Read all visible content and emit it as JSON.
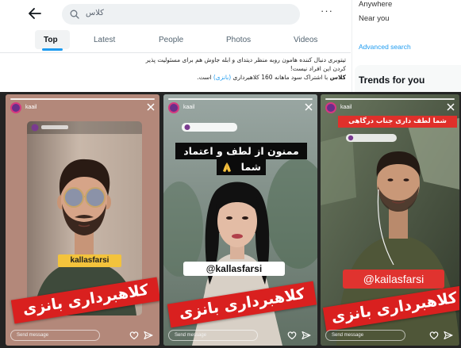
{
  "header": {
    "back_icon": "back-arrow-icon",
    "search_icon": "search-icon",
    "search_query": "کلاس",
    "more_label": "···"
  },
  "tabs": [
    {
      "label": "Top",
      "active": true
    },
    {
      "label": "Latest",
      "active": false
    },
    {
      "label": "People",
      "active": false
    },
    {
      "label": "Photos",
      "active": false
    },
    {
      "label": "Videos",
      "active": false
    }
  ],
  "tweet": {
    "line1": "تیتوبری دنبال کننده هامون روبه منظر دیتدای و ابله جاوش هم برای مسئولیت پذیر",
    "line2": "کردن این افراد نیست!",
    "line3_bold": "کلاس",
    "line3_rest": "با اشتراک سود ماهانه 160 کلاهبرداری",
    "line3_link": "(بانزی)",
    "line3_end": "است."
  },
  "sidebar": {
    "anywhere": "Anywhere",
    "near_you": "Near you",
    "advanced_search": "Advanced search",
    "trends_title": "Trends for you"
  },
  "colors": {
    "accent": "#1d9bf0",
    "banner_red": "#d9201f",
    "label_yellow": "#f3c33c"
  },
  "stories": [
    {
      "user": "kaail",
      "label": "kallasfarsi",
      "banner": "کلاهبرداری بانزی",
      "reply_placeholder": "Send message"
    },
    {
      "user": "kaail",
      "caption_line1": "ممنون از لطف و اعتماد",
      "caption_line2": "شما",
      "caption_icon": "praying-hands-icon",
      "label": "@kallasfarsi",
      "banner": "کلاهبرداری بانزی",
      "reply_placeholder": "Send message"
    },
    {
      "user": "kaail",
      "caption": "شما لطف داری جناب درگاهی",
      "label": "@kailasfarsi",
      "banner": "کلاهبرداری بانزی",
      "reply_placeholder": "Send message"
    }
  ]
}
